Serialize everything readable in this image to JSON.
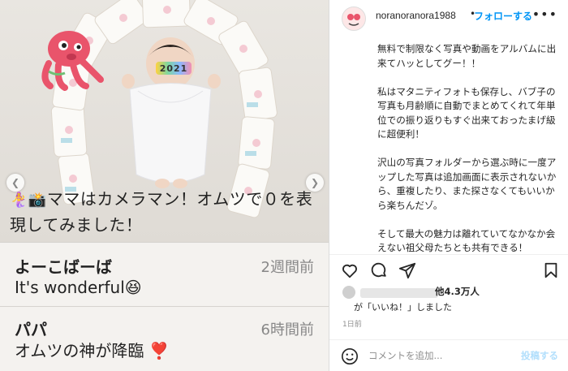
{
  "post": {
    "overlay_badge": "2021",
    "caption": "ママはカメラマン！オムツで０を表現してみました！",
    "comments": [
      {
        "name": "よーこばーば",
        "time": "2週間前",
        "text": "It's wonderful😆"
      },
      {
        "name": "パパ",
        "time": "6時間前",
        "text": "オムツの神が降臨 ❣️"
      }
    ]
  },
  "sidebar": {
    "username": "noranoranora1988",
    "separator": "•",
    "follow_label": "フォローする",
    "more_label": "•••",
    "paragraphs": [
      "無料で制限なく写真や動画をアルバムに出来てハッとしてグー！！",
      "私はマタニティフォトも保存し、バブ子の写真も月齢順に自動でまとめてくれて年単位での振り返りもすぐ出来ておったまげ級に超便利！",
      "沢山の写真フォルダーから選ぶ時に一度アップした写真は追加画面に表示されないから、重複したり、また探さなくてもいいから楽ちんだゾ。",
      "そして最大の魅力は離れていてなかなか会えない祖父母たちとも共有できる！"
    ],
    "likes_count": "他4.3万人",
    "likes_sub": "が「いいね！」しました",
    "date": "1日前",
    "comment_placeholder": "コメントを追加...",
    "post_label": "投稿する"
  },
  "colors": {
    "link_blue": "#0095f6",
    "post_disabled": "#b2dffc"
  }
}
